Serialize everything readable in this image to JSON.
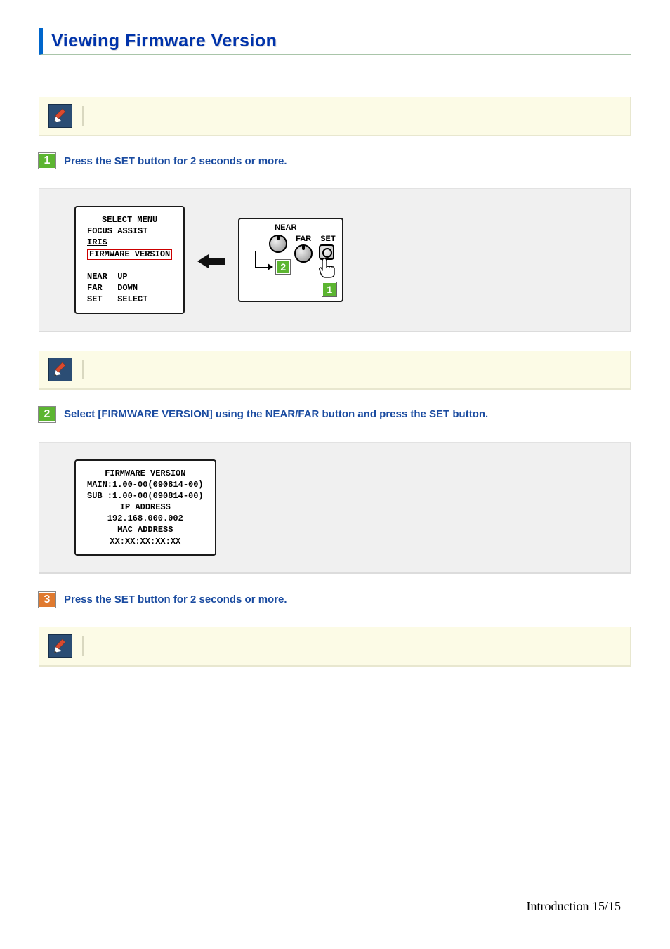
{
  "heading": "Viewing Firmware Version",
  "steps": {
    "s1": {
      "num": "1",
      "text": "Press the SET button for 2 seconds or more."
    },
    "s2": {
      "num": "2",
      "text": "Select [FIRMWARE VERSION] using the NEAR/FAR button and press the SET button."
    },
    "s3": {
      "num": "3",
      "text": "Press the SET button for 2 seconds or more."
    }
  },
  "menu_screen": {
    "title": "SELECT MENU",
    "item1": "FOCUS ASSIST",
    "item2": "IRIS",
    "item3_highlight": "FIRMWARE VERSION",
    "hints_col1_l1": "NEAR",
    "hints_col1_l2": "FAR",
    "hints_col1_l3": "SET",
    "hints_col2_l1": "UP",
    "hints_col2_l2": "DOWN",
    "hints_col2_l3": "SELECT"
  },
  "controls": {
    "near": "NEAR",
    "far": "FAR",
    "set": "SET",
    "callout1": "1",
    "callout2": "2"
  },
  "fw_screen": {
    "l1": "FIRMWARE VERSION",
    "l2": "MAIN:1.00-00(090814-00)",
    "l3": "SUB :1.00-00(090814-00)",
    "l4": "IP ADDRESS",
    "l5": "192.168.000.002",
    "l6": "MAC ADDRESS",
    "l7": "XX:XX:XX:XX:XX"
  },
  "footer": "Introduction 15/15"
}
